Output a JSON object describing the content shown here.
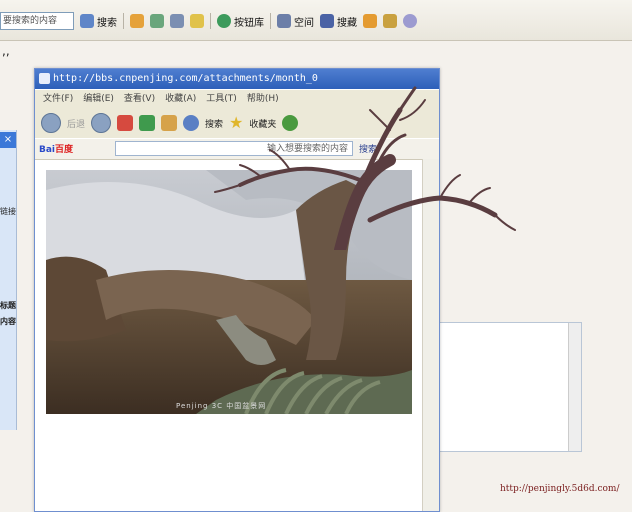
{
  "background_browser": {
    "search_placeholder": "要搜索的内容",
    "toolbar": {
      "search_label": "搜索",
      "bookmark_label": "按钮库",
      "space_label": "空间",
      "collect_label": "搜藏"
    },
    "page_text": ",,"
  },
  "popup": {
    "url": "http://bbs.cnpenjing.com/attachments/month_0",
    "menu": [
      "文件(F)",
      "编辑(E)",
      "查看(V)",
      "收藏(A)",
      "工具(T)",
      "帮助(H)"
    ],
    "toolbar": {
      "back_label": "后退",
      "search_label": "搜索",
      "favorites_label": "收藏夹"
    },
    "baidu": {
      "logo_text": "Bai",
      "logo_accent": "百度",
      "input_placeholder": "输入想要搜索的内容",
      "search_label": "搜索"
    }
  },
  "photo": {
    "caption": "Penjing 3C 中国盆景网"
  },
  "footer_url": "http://penjingly.5d6d.com/",
  "left_panel": {
    "label_1": "链接",
    "label_2": "标题",
    "label_3": "内容"
  },
  "colors": {
    "title_blue": "#2d5fb9",
    "footer_red": "#7a1e1e"
  }
}
